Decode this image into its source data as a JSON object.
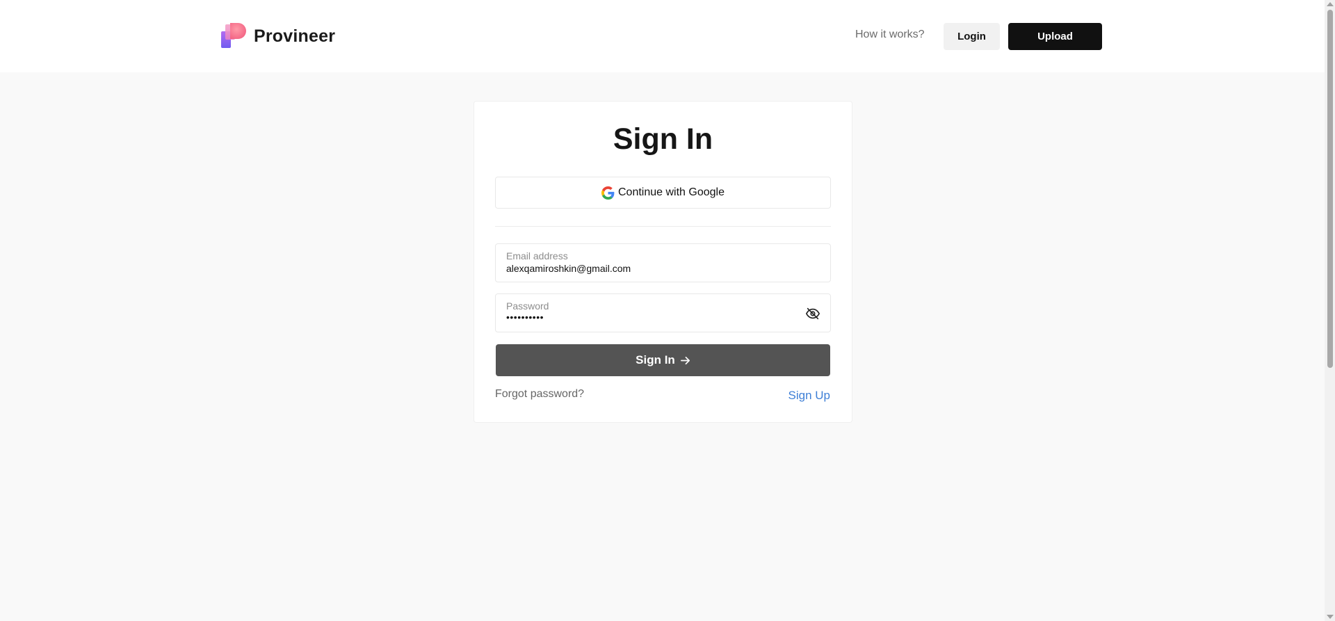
{
  "header": {
    "brand": "Provineer",
    "nav_link": "How it works?",
    "login_label": "Login",
    "upload_label": "Upload"
  },
  "signin": {
    "title": "Sign In",
    "google_label": "Continue with Google",
    "email": {
      "label": "Email address",
      "value": "alexqamiroshkin@gmail.com"
    },
    "password": {
      "label": "Password",
      "value": "••••••••••"
    },
    "submit_label": "Sign In",
    "forgot_label": "Forgot password?",
    "signup_label": "Sign Up"
  },
  "colors": {
    "page_bg": "#f9f9f9",
    "primary_dark": "#111111",
    "submit_bg": "#545454",
    "link_blue": "#3e7fd6"
  },
  "icons": {
    "logo": "provineer-logo-icon",
    "google": "google-g-icon",
    "password_toggle": "eye-off-icon",
    "submit_arrow": "arrow-right-icon"
  }
}
